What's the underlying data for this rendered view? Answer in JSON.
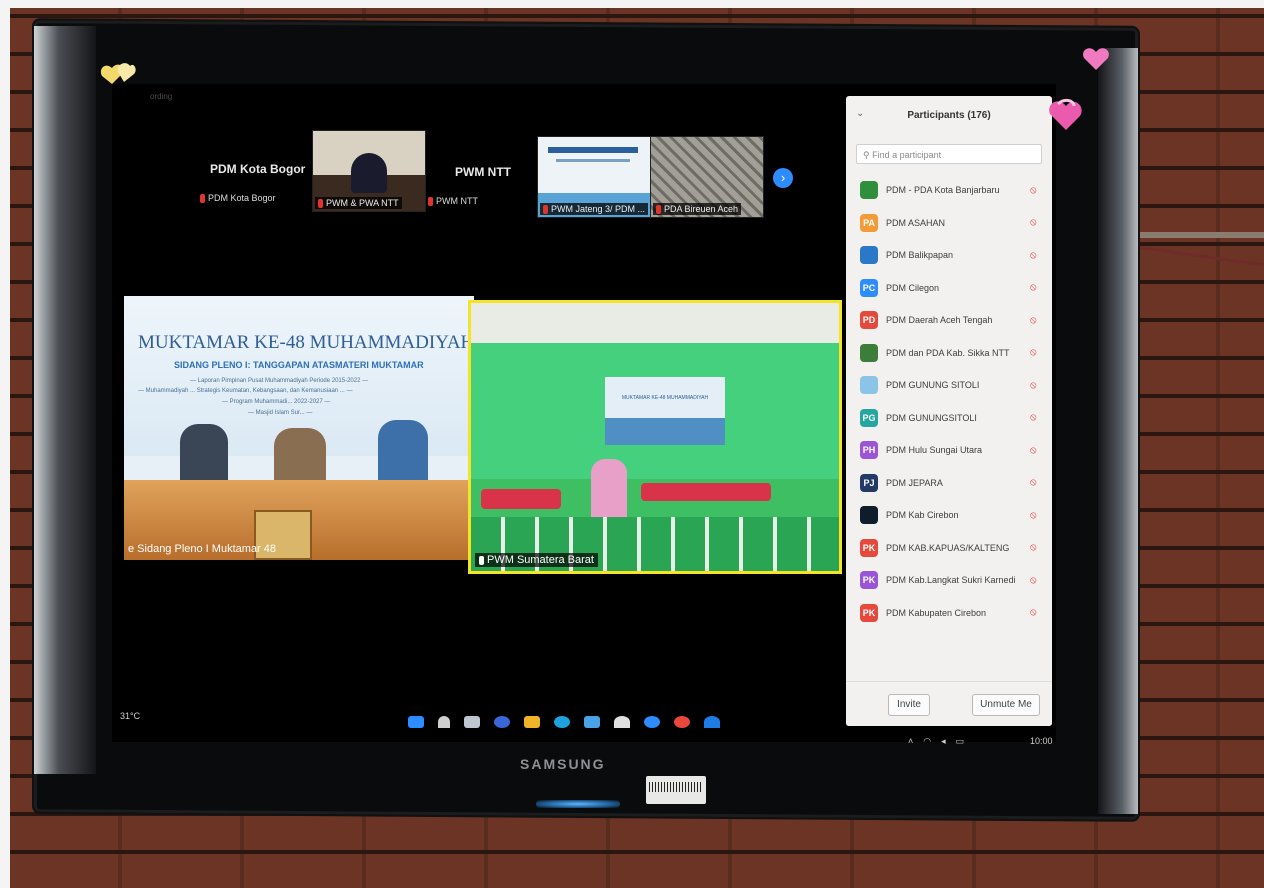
{
  "tv": {
    "brand": "SAMSUNG"
  },
  "screen": {
    "recording_label": "ording",
    "gallery": [
      {
        "big_name": "PDM Kota Bogor",
        "small_name": "PDM Kota Bogor"
      },
      {
        "video_label": "PWM & PWA NTT"
      },
      {
        "big_name": "PWM NTT",
        "small_name": "PWM NTT"
      },
      {
        "video_label": "PWM Jateng 3/ PDM ..."
      },
      {
        "video_label": "PDA Bireuen Aceh"
      }
    ],
    "next_icon": "chevron-right-icon",
    "main_left": {
      "banner_title": "MUKTAMAR KE-48 MUHAMMADIYAH",
      "banner_subtitle": "SIDANG PLENO I: TANGGAPAN ATASMATERI MUKTAMAR",
      "banner_lines": [
        "— Laporan Pimpinan Pusat Muhammadiyah Periode 2015-2022 —",
        "— Muhammadiyah ... Strategis Keumatan, Kebangsaan, dan Kemanusiaan ... —",
        "— Program Muhammadi... 2022-2027 —",
        "— Masjid Islam Sur... —"
      ],
      "label": "e Sidang Pleno I Muktamar 48"
    },
    "main_right": {
      "banner_title": "MUKTAMAR KE-48 MUHAMMADIYAH",
      "label": "PWM Sumatera Barat"
    },
    "participants": {
      "title": "Participants (176)",
      "search_placeholder": "Find a participant",
      "items": [
        {
          "avatar": "",
          "avatar_color": "#2f8f3a",
          "name": "PDM - PDA Kota Banjarbaru"
        },
        {
          "avatar": "PA",
          "avatar_color": "#f29b38",
          "name": "PDM ASAHAN"
        },
        {
          "avatar": "",
          "avatar_color": "#2a78c8",
          "name": "PDM Balikpapan"
        },
        {
          "avatar": "PC",
          "avatar_color": "#2d8cff",
          "name": "PDM Cilegon"
        },
        {
          "avatar": "PD",
          "avatar_color": "#e6493b",
          "name": "PDM Daerah Aceh Tengah"
        },
        {
          "avatar": "",
          "avatar_color": "#3c7d3a",
          "name": "PDM dan PDA Kab. Sikka NTT"
        },
        {
          "avatar": "",
          "avatar_color": "#8cc4e8",
          "name": "PDM GUNUNG SITOLI"
        },
        {
          "avatar": "PG",
          "avatar_color": "#23a7a0",
          "name": "PDM GUNUNGSITOLI"
        },
        {
          "avatar": "PH",
          "avatar_color": "#9a54d6",
          "name": "PDM Hulu Sungai Utara"
        },
        {
          "avatar": "PJ",
          "avatar_color": "#233a66",
          "name": "PDM JEPARA"
        },
        {
          "avatar": "",
          "avatar_color": "#0f1c2a",
          "name": "PDM Kab Cirebon"
        },
        {
          "avatar": "PK",
          "avatar_color": "#e6493b",
          "name": "PDM KAB.KAPUAS/KALTENG"
        },
        {
          "avatar": "PK",
          "avatar_color": "#9a54d6",
          "name": "PDM Kab.Langkat Sukri Karnedi"
        },
        {
          "avatar": "PK",
          "avatar_color": "#e6493b",
          "name": "PDM Kabupaten Cirebon"
        }
      ],
      "invite_label": "Invite",
      "unmute_label": "Unmute Me"
    },
    "taskbar": {
      "temperature": "31°C",
      "clock": "10:00"
    }
  }
}
